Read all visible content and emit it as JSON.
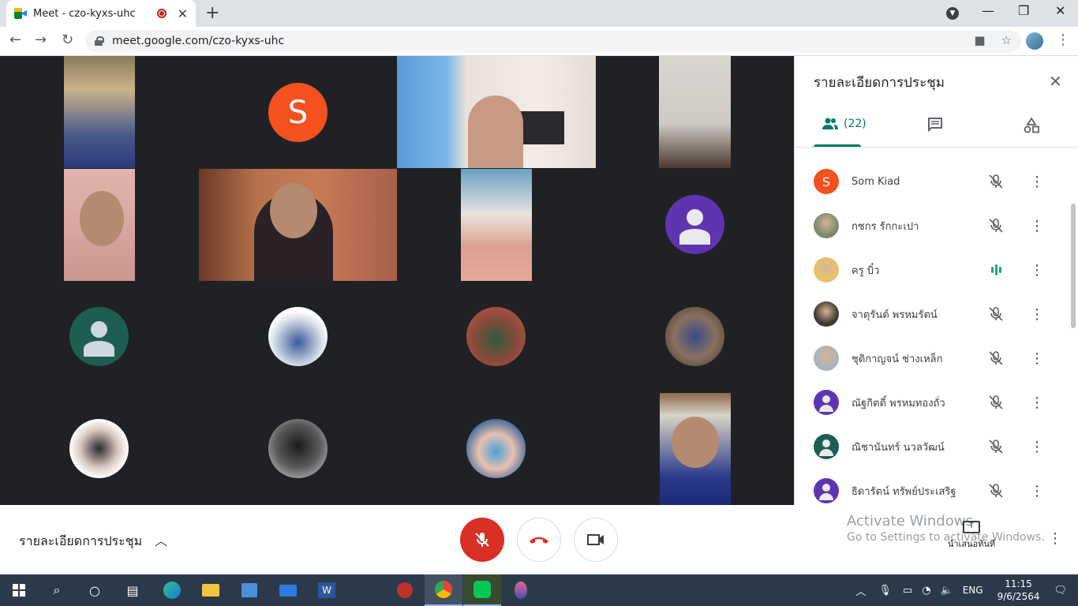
{
  "browser": {
    "tab_title": "Meet - czo-kyxs-uhc",
    "tab_close": "✕",
    "new_tab": "+",
    "url": "meet.google.com/czo-kyxs-uhc",
    "back_icon": "←",
    "forward_icon": "→",
    "reload_icon": "↻",
    "min_icon": "—",
    "max_icon": "❐",
    "close_icon": "✕",
    "star_icon": "☆",
    "camera_icon": "■",
    "menu_icon": "⋮"
  },
  "panel": {
    "title": "รายละเอียดการประชุม",
    "close": "✕",
    "people_count": "(22)",
    "people": [
      {
        "name": "Som Kiad",
        "avatar": "letter",
        "letter": "S",
        "color": "#f4511e",
        "mic": "muted"
      },
      {
        "name": "กชกร รักกะเปา",
        "avatar": "photo",
        "color": "#7a8b6a",
        "mic": "muted"
      },
      {
        "name": "ครู บิ๋ว",
        "avatar": "photo",
        "color": "#e8c46a",
        "mic": "speaking"
      },
      {
        "name": "จาตุรันต์ พรหมรัตน์",
        "avatar": "photo",
        "color": "#3e3a2f",
        "mic": "muted"
      },
      {
        "name": "ชุติกาญจน์ ช่างเหล็ก",
        "avatar": "photo",
        "color": "#a9b3bb",
        "mic": "muted"
      },
      {
        "name": "ณัฐกิตติ์ พรหมทองถั่ว",
        "avatar": "silhouette",
        "color": "#5e35b1",
        "mic": "muted"
      },
      {
        "name": "ณิชานันทร์ นวลวัฒน์",
        "avatar": "silhouette",
        "color": "#1e5e50",
        "mic": "muted"
      },
      {
        "name": "ธิดารัตน์ ทรัพย์ประเสริฐ",
        "avatar": "silhouette",
        "color": "#5e35b1",
        "mic": "muted"
      }
    ]
  },
  "stage": {
    "letter_tile": "S"
  },
  "bottom": {
    "meeting_details": "รายละเอียดการประชุม",
    "present_label": "นำเสนอทันที",
    "activate_line1": "Activate Windows",
    "activate_line2": "Go to Settings to activate Windows."
  },
  "taskbar": {
    "lang": "ENG",
    "time": "11:15",
    "date": "9/6/2564"
  },
  "colors": {
    "stage_bg": "#202124",
    "accent": "#00796b",
    "end_call": "#d93025",
    "taskbar": "#2b3a4a"
  }
}
